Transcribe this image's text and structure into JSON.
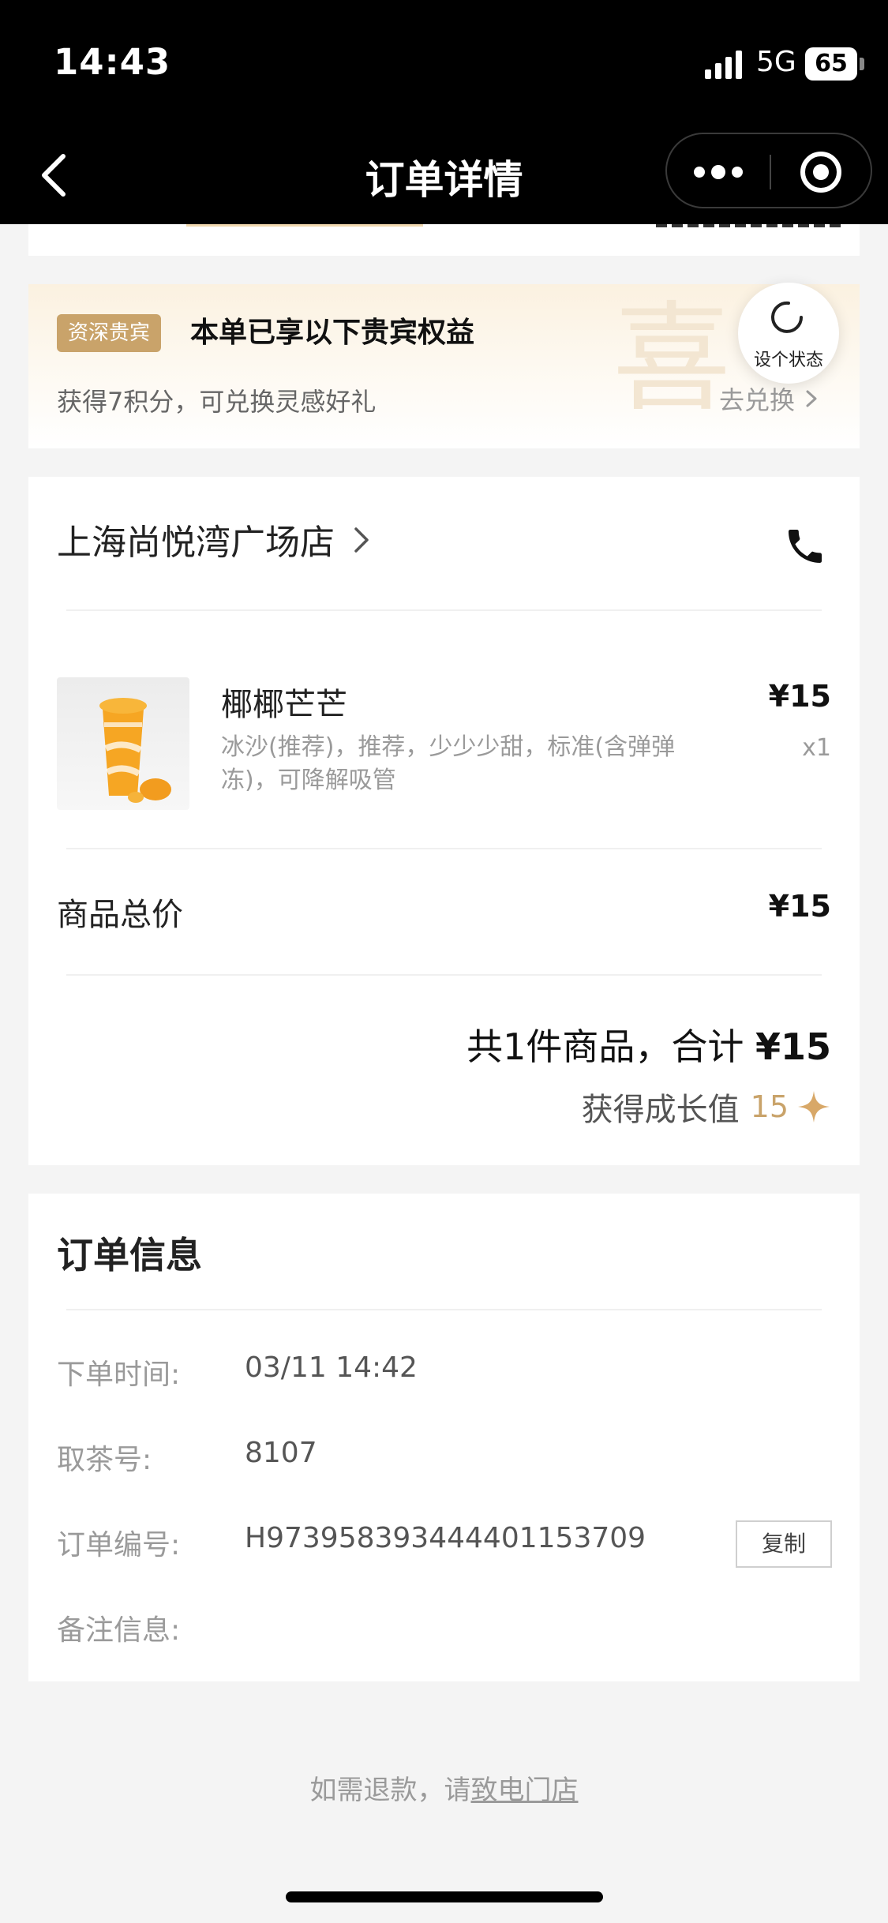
{
  "status_bar": {
    "time": "14:43",
    "network": "5G",
    "battery": "65"
  },
  "nav": {
    "title": "订单详情",
    "icons": {
      "back": "chevron-left-icon",
      "more": "more-dots-icon",
      "close": "target-icon"
    }
  },
  "vip": {
    "badge": "资深贵宾",
    "title": "本单已享以下贵宾权益",
    "desc": "获得7积分，可兑换灵感好礼",
    "redeem_label": "去兑换",
    "watermark": "喜"
  },
  "status_bubble": {
    "label": "设个状态"
  },
  "order": {
    "store_name": "上海尚悦湾广场店",
    "item": {
      "name": "椰椰芒芒",
      "spec": "冰沙(推荐)，推荐，少少少甜，标准(含弹弹冻)，可降解吸管",
      "price": "¥15",
      "qty": "x1"
    },
    "subtotal_label": "商品总价",
    "subtotal_value": "¥15",
    "total_prefix": "共1件商品，合计 ",
    "total_amount": "¥15",
    "growth_label": "获得成长值",
    "growth_value": "15"
  },
  "info": {
    "title": "订单信息",
    "rows": [
      {
        "label": "下单时间:",
        "value": "03/11 14:42"
      },
      {
        "label": "取茶号:",
        "value": "8107"
      },
      {
        "label": "订单编号:",
        "value": "H97395839344440115370​9"
      },
      {
        "label": "备注信息:",
        "value": ""
      }
    ],
    "copy_label": "复制"
  },
  "footer": {
    "refund_prefix": "如需退款，请",
    "refund_link": "致电门店"
  },
  "colors": {
    "gold": "#c9a36a",
    "header_bg": "#000000",
    "page_bg": "#f4f4f4"
  }
}
